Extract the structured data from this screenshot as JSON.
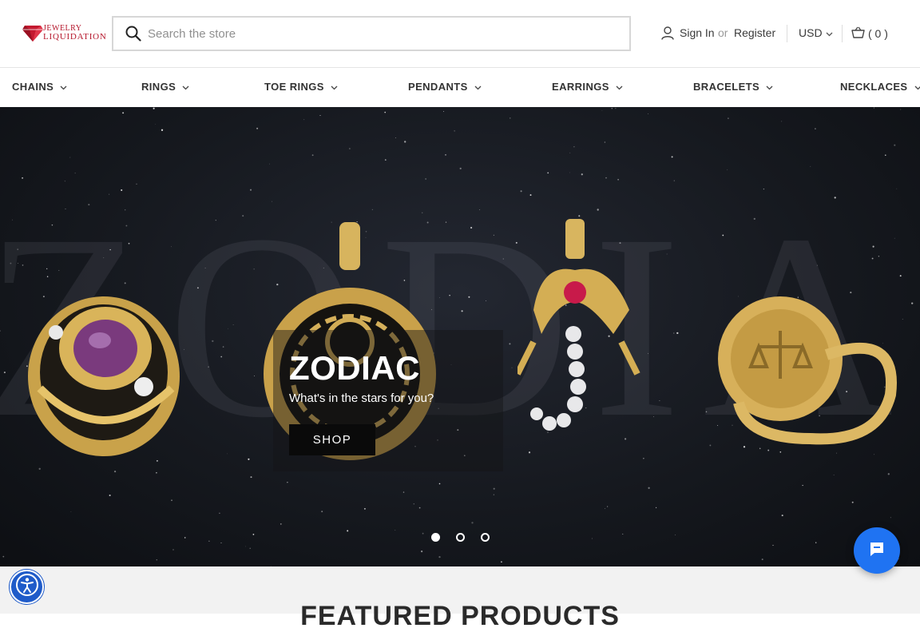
{
  "brand": {
    "name_line1": "JEWELRY",
    "name_line2": "LIQUIDATION",
    "color": "#b5162b"
  },
  "search": {
    "placeholder": "Search the store",
    "value": ""
  },
  "account": {
    "signin_label": "Sign In",
    "or_label": "or",
    "register_label": "Register"
  },
  "currency": {
    "label": "USD"
  },
  "cart": {
    "count_label": "( 0 )"
  },
  "categories": [
    {
      "label": "CHAINS"
    },
    {
      "label": "RINGS"
    },
    {
      "label": "TOE RINGS"
    },
    {
      "label": "PENDANTS"
    },
    {
      "label": "EARRINGS"
    },
    {
      "label": "BRACELETS"
    },
    {
      "label": "NECKLACES"
    }
  ],
  "hero": {
    "background_word": "ZODIAC",
    "title": "ZODIAC",
    "subtitle": "What's in the stars for you?",
    "button_label": "SHOP",
    "slide_count": 3,
    "active_slide": 1
  },
  "section": {
    "featured_title": "FEATURED PRODUCTS"
  },
  "colors": {
    "accent_chat": "#1f73f2",
    "accessibility": "#1f5bc9"
  },
  "icons": [
    "search-icon",
    "user-icon",
    "chevron-down-icon",
    "basket-icon",
    "chat-icon",
    "accessibility-icon"
  ]
}
